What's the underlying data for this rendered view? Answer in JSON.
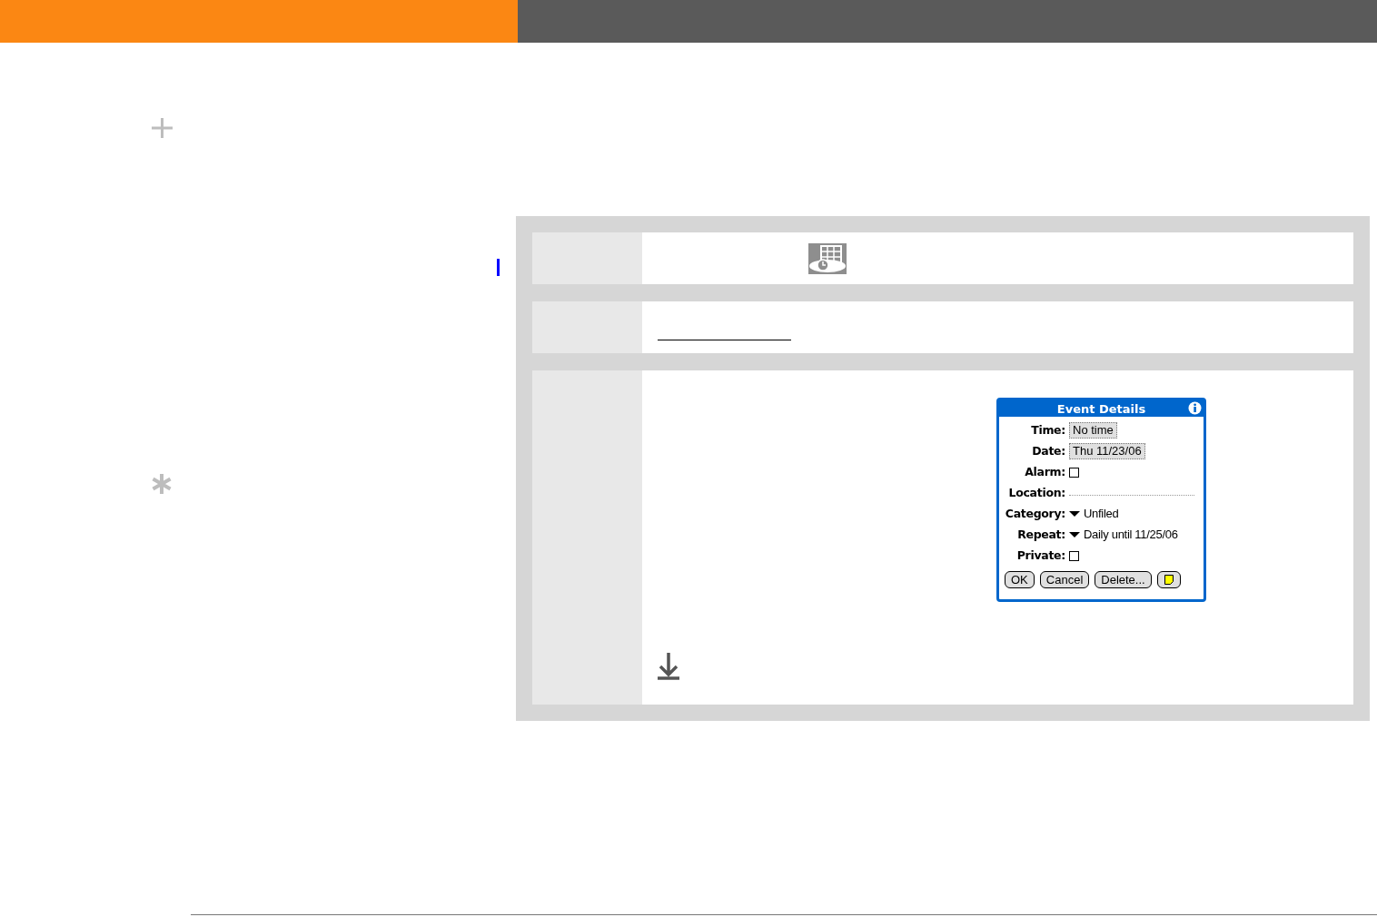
{
  "dialog": {
    "title": "Event Details",
    "fields": [
      {
        "label": "Time:",
        "kind": "button",
        "value": "No time"
      },
      {
        "label": "Date:",
        "kind": "button",
        "value": "Thu 11/23/06"
      },
      {
        "label": "Alarm:",
        "kind": "checkbox",
        "checked": false
      },
      {
        "label": "Location:",
        "kind": "line"
      },
      {
        "label": "Category:",
        "kind": "dropdown",
        "value": "Unfiled"
      },
      {
        "label": "Repeat:",
        "kind": "dropdown",
        "value": "Daily until 11/25/06"
      },
      {
        "label": "Private:",
        "kind": "checkbox",
        "checked": false
      }
    ],
    "buttons": [
      "OK",
      "Cancel",
      "Delete..."
    ]
  }
}
